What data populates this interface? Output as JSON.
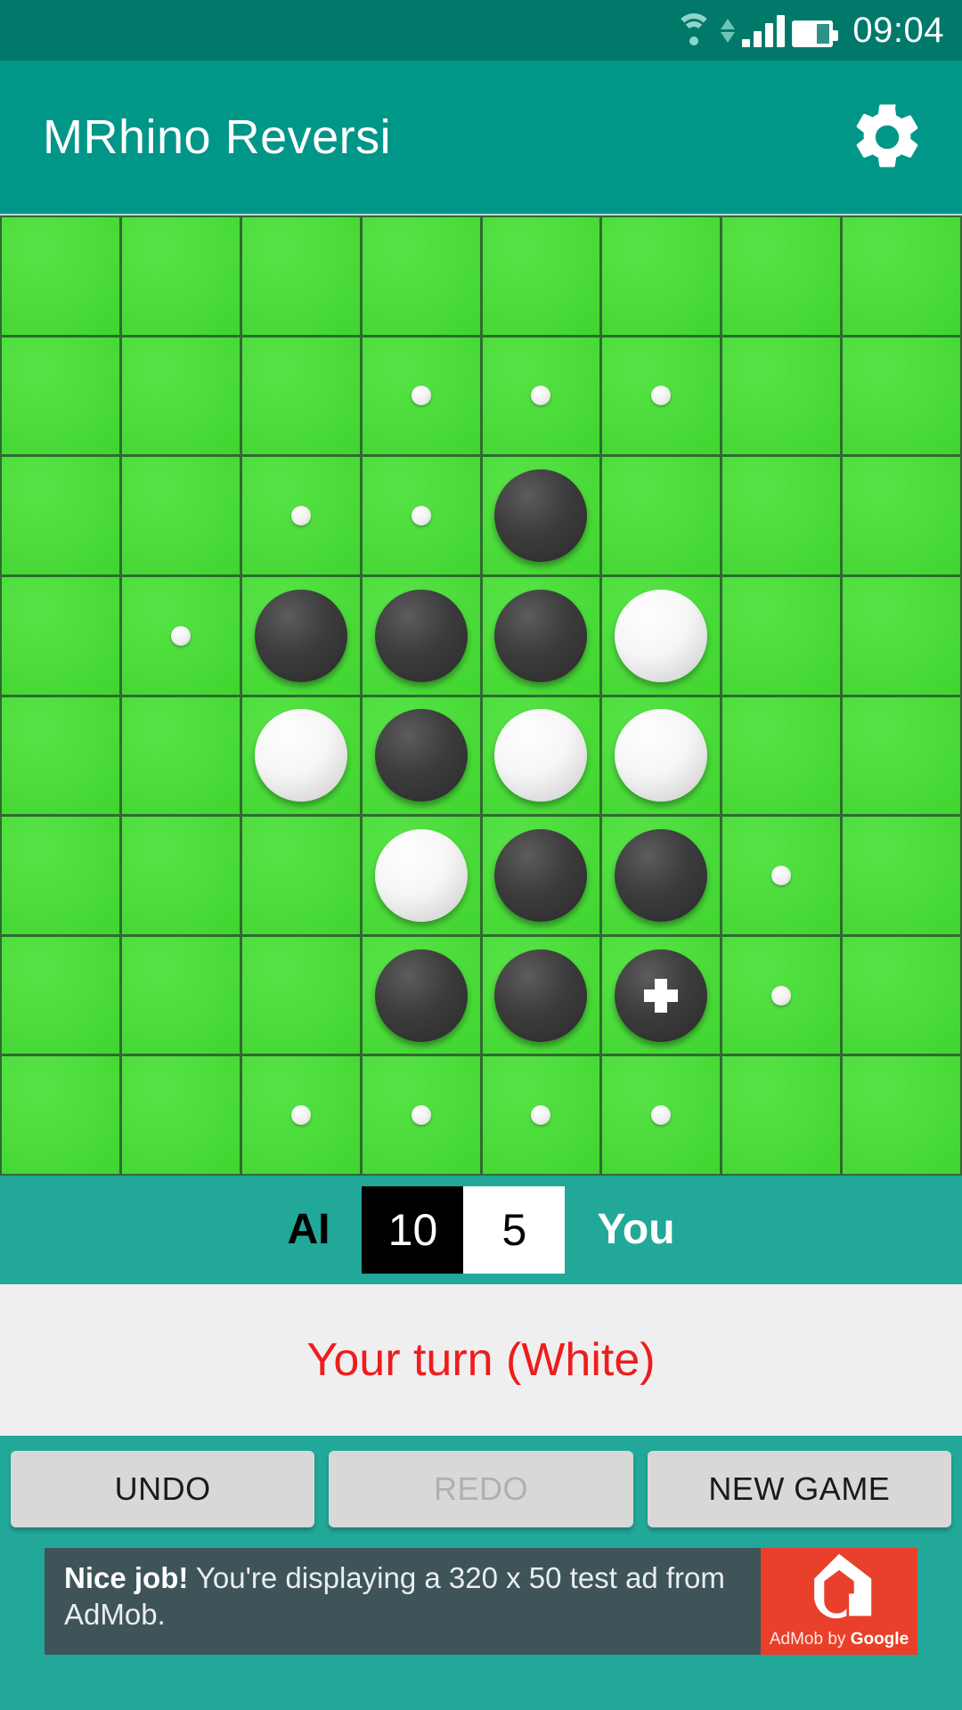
{
  "statusbar": {
    "clock": "09:04",
    "icons": [
      "wifi-icon",
      "data-transfer-icon",
      "signal-icon",
      "battery-icon"
    ],
    "battery_level_pct": 62,
    "signal_bars": 4
  },
  "appbar": {
    "title": "MRhino Reversi",
    "settings_icon": "gear-icon",
    "background": "#009688"
  },
  "board": {
    "rows": 8,
    "cols": 8,
    "cell_color": "#44e032",
    "grid_line_color": "#2f6b2f",
    "legend": {
      "empty": "",
      "black": "B",
      "white": "W",
      "hint": "h",
      "black_last_move": "B*"
    },
    "cells": [
      [
        "",
        "",
        "",
        "",
        "",
        "",
        "",
        ""
      ],
      [
        "",
        "",
        "",
        "h",
        "h",
        "h",
        "",
        ""
      ],
      [
        "",
        "",
        "h",
        "h",
        "B",
        "",
        "",
        ""
      ],
      [
        "",
        "h",
        "B",
        "B",
        "B",
        "W",
        "",
        ""
      ],
      [
        "",
        "",
        "W",
        "B",
        "W",
        "W",
        "",
        ""
      ],
      [
        "",
        "",
        "",
        "W",
        "B",
        "B",
        "h",
        ""
      ],
      [
        "",
        "",
        "",
        "B",
        "B",
        "B*",
        "h",
        ""
      ],
      [
        "",
        "",
        "h",
        "h",
        "h",
        "h",
        "",
        ""
      ]
    ]
  },
  "scorebar": {
    "ai_label": "AI",
    "ai_score": "10",
    "you_score": "5",
    "you_label": "You",
    "background": "#22a899"
  },
  "status": {
    "message": "Your turn (White)",
    "color": "#ef1c1c"
  },
  "buttons": {
    "undo": "UNDO",
    "redo": "REDO",
    "new_game": "NEW GAME",
    "redo_disabled": true
  },
  "ad": {
    "headline": "Nice job!",
    "body": " You're displaying a 320 x 50 test ad from AdMob.",
    "brand_prefix": "AdMob by ",
    "brand_suffix": "Google",
    "logo_color": "#e8402a",
    "background": "#3f5459"
  }
}
